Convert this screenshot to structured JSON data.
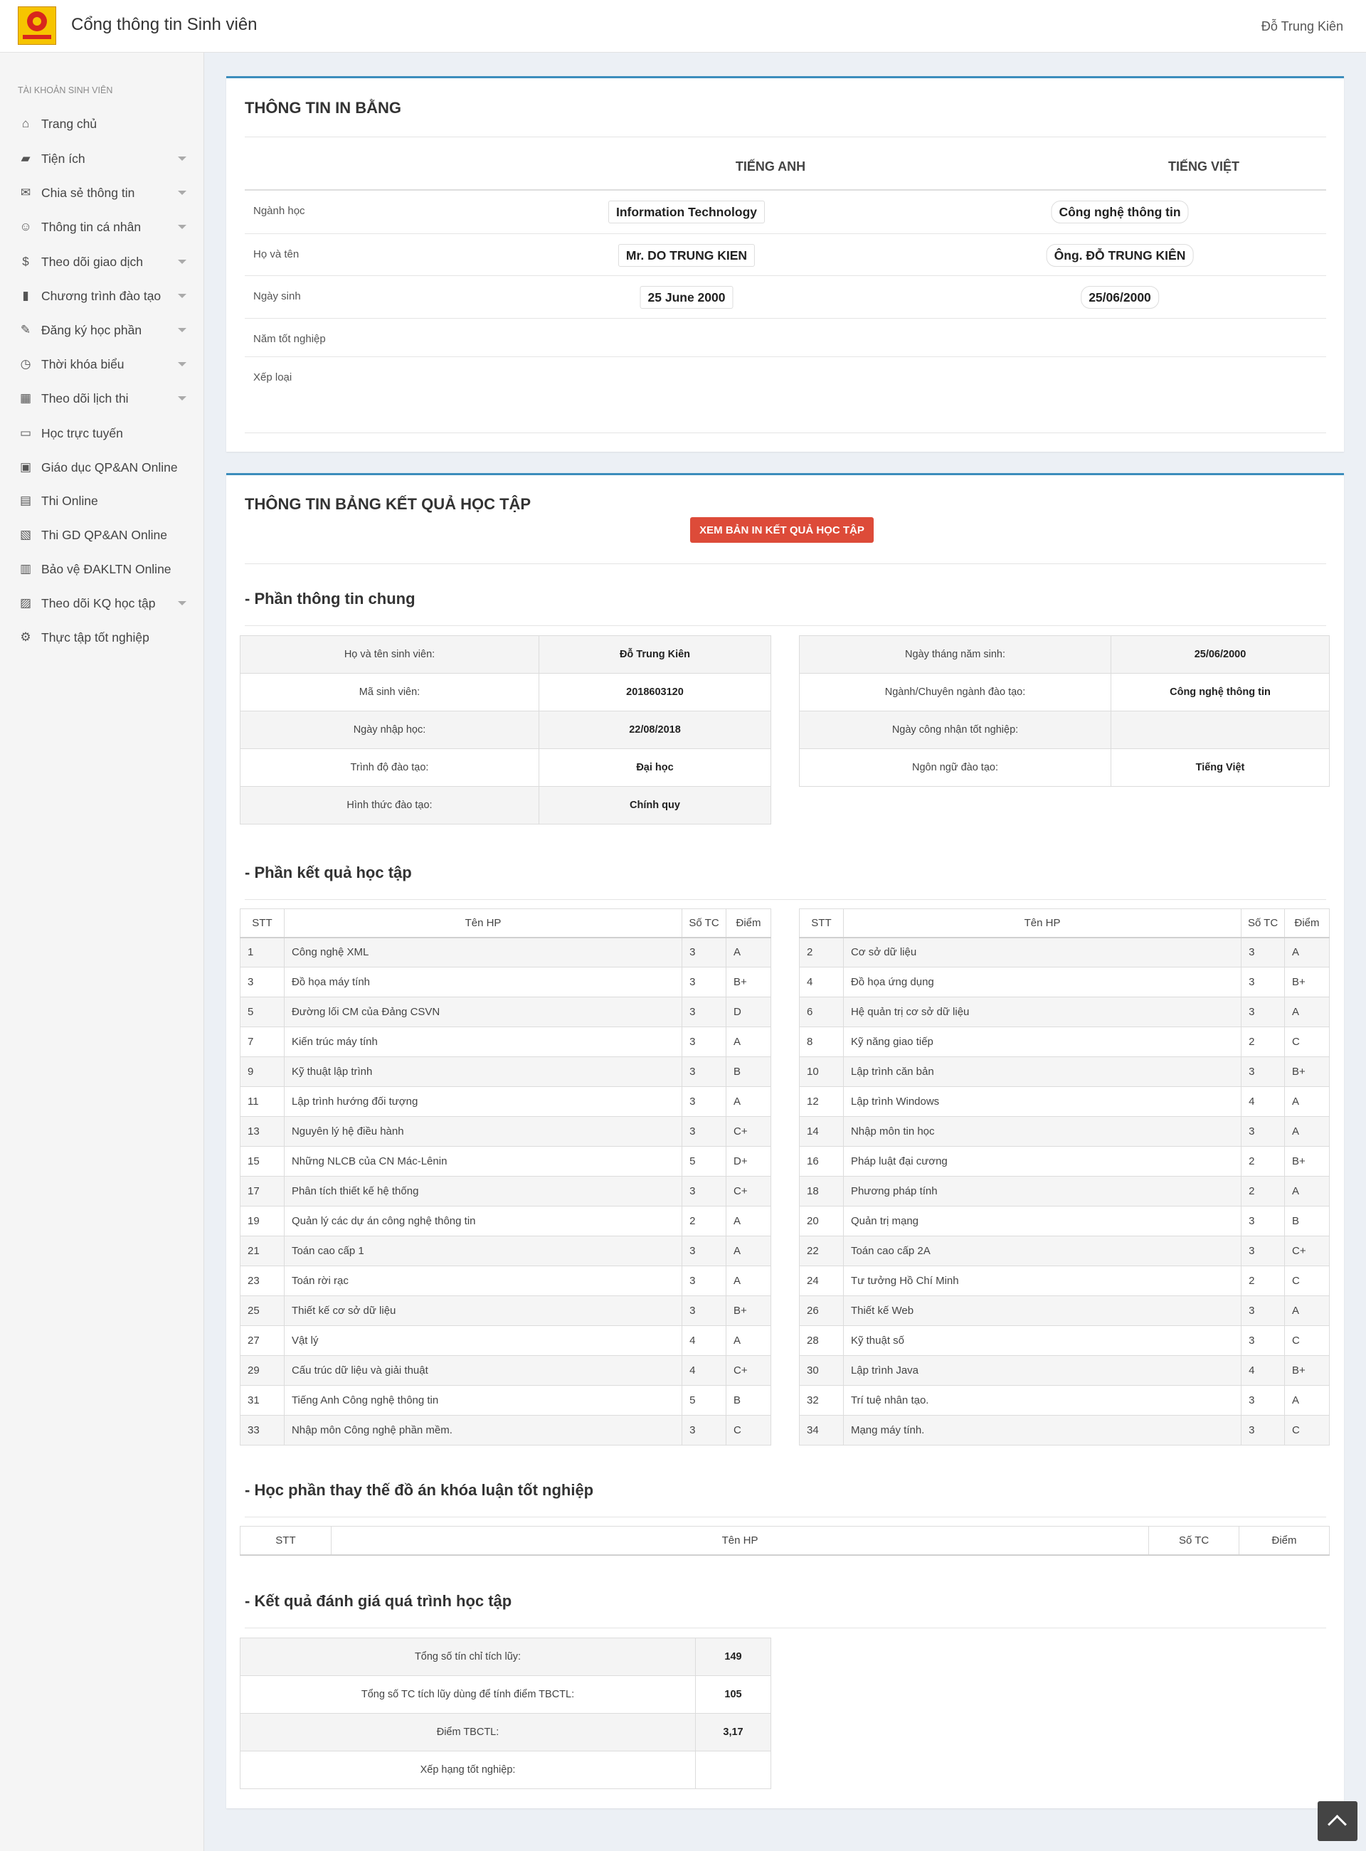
{
  "header": {
    "app_title": "Cổng thông tin Sinh viên",
    "user_name": "Đỗ Trung Kiên"
  },
  "sidebar": {
    "heading": "TÀI KHOẢN SINH VIÊN",
    "items": [
      {
        "label": "Trang chủ",
        "icon": "home-icon",
        "glyph": "⌂",
        "expandable": false
      },
      {
        "label": "Tiện ích",
        "icon": "book-icon",
        "glyph": "▰",
        "expandable": true
      },
      {
        "label": "Chia sẻ thông tin",
        "icon": "chat-icon",
        "glyph": "✉",
        "expandable": true
      },
      {
        "label": "Thông tin cá nhân",
        "icon": "face-icon",
        "glyph": "☺",
        "expandable": true
      },
      {
        "label": "Theo dõi giao dịch",
        "icon": "money-icon",
        "glyph": "$",
        "expandable": true
      },
      {
        "label": "Chương trình đào tạo",
        "icon": "notebook-icon",
        "glyph": "▮",
        "expandable": true
      },
      {
        "label": "Đăng ký học phần",
        "icon": "register-icon",
        "glyph": "✎",
        "expandable": true
      },
      {
        "label": "Thời khóa biểu",
        "icon": "alarm-clock-icon",
        "glyph": "◷",
        "expandable": true
      },
      {
        "label": "Theo dõi lịch thi",
        "icon": "calendar-icon",
        "glyph": "▦",
        "expandable": true
      },
      {
        "label": "Học trực tuyến",
        "icon": "laptop-icon",
        "glyph": "▭",
        "expandable": false
      },
      {
        "label": "Giáo dục QP&AN Online",
        "icon": "bus-icon",
        "glyph": "▣",
        "expandable": false
      },
      {
        "label": "Thi Online",
        "icon": "document-icon",
        "glyph": "▤",
        "expandable": false
      },
      {
        "label": "Thi GD QP&AN Online",
        "icon": "wallet-icon",
        "glyph": "▧",
        "expandable": false
      },
      {
        "label": "Bảo vệ ĐAKLTN Online",
        "icon": "report-icon",
        "glyph": "▥",
        "expandable": false
      },
      {
        "label": "Theo dõi KQ học tập",
        "icon": "transcript-icon",
        "glyph": "▨",
        "expandable": true
      },
      {
        "label": "Thực tập tốt nghiệp",
        "icon": "hierarchy-icon",
        "glyph": "⚙",
        "expandable": false
      }
    ]
  },
  "print_info": {
    "title": "THÔNG TIN IN BẰNG",
    "col_en": "TIẾNG ANH",
    "col_vi": "TIẾNG VIỆT",
    "rows": [
      {
        "label": "Ngành học",
        "en": "Information Technology",
        "vi": "Công nghệ thông tin"
      },
      {
        "label": "Họ và tên",
        "en": "Mr. DO TRUNG KIEN",
        "vi": "Ông. ĐỖ TRUNG KIÊN"
      },
      {
        "label": "Ngày sinh",
        "en": "25 June 2000",
        "vi": "25/06/2000"
      },
      {
        "label": "Năm tốt nghiệp",
        "en": "",
        "vi": ""
      },
      {
        "label": "Xếp loại",
        "en": "",
        "vi": ""
      }
    ]
  },
  "results": {
    "title": "THÔNG TIN BẢNG KẾT QUẢ HỌC TẬP",
    "print_button": "XEM BẢN IN KẾT QUẢ HỌC TẬP",
    "general_title": "- Phần thông tin chung",
    "general_left": [
      {
        "label": "Họ và tên sinh viên:",
        "value": "Đỗ Trung Kiên"
      },
      {
        "label": "Mã sinh viên:",
        "value": "2018603120"
      },
      {
        "label": "Ngày nhập học:",
        "value": "22/08/2018"
      },
      {
        "label": "Trình độ đào tạo:",
        "value": "Đại học"
      },
      {
        "label": "Hình thức đào tạo:",
        "value": "Chính quy"
      }
    ],
    "general_right": [
      {
        "label": "Ngày tháng năm sinh:",
        "value": "25/06/2000"
      },
      {
        "label": "Ngành/Chuyên ngành đào tạo:",
        "value": "Công nghệ thông tin"
      },
      {
        "label": "Ngày công nhận tốt nghiệp:",
        "value": ""
      },
      {
        "label": "Ngôn ngữ đào tạo:",
        "value": "Tiếng Việt"
      }
    ],
    "grades_title": "- Phần kết quả học tập",
    "grade_headers": [
      "STT",
      "Tên HP",
      "Số TC",
      "Điểm"
    ],
    "grades_left": [
      [
        "1",
        "Công nghệ XML",
        "3",
        "A"
      ],
      [
        "3",
        "Đồ họa máy tính",
        "3",
        "B+"
      ],
      [
        "5",
        "Đường lối CM của Đảng CSVN",
        "3",
        "D"
      ],
      [
        "7",
        "Kiến trúc máy tính",
        "3",
        "A"
      ],
      [
        "9",
        "Kỹ thuật lập trình",
        "3",
        "B"
      ],
      [
        "11",
        "Lập trình hướng đối tượng",
        "3",
        "A"
      ],
      [
        "13",
        "Nguyên lý hệ điều hành",
        "3",
        "C+"
      ],
      [
        "15",
        "Những NLCB của CN Mác-Lênin",
        "5",
        "D+"
      ],
      [
        "17",
        "Phân tích thiết kế hệ thống",
        "3",
        "C+"
      ],
      [
        "19",
        "Quản lý các dự án công nghệ thông tin",
        "2",
        "A"
      ],
      [
        "21",
        "Toán cao cấp 1",
        "3",
        "A"
      ],
      [
        "23",
        "Toán rời rạc",
        "3",
        "A"
      ],
      [
        "25",
        "Thiết kế cơ sở dữ liệu",
        "3",
        "B+"
      ],
      [
        "27",
        "Vật lý",
        "4",
        "A"
      ],
      [
        "29",
        "Cấu trúc dữ liệu và giải thuật",
        "4",
        "C+"
      ],
      [
        "31",
        "Tiếng Anh Công nghệ thông tin",
        "5",
        "B"
      ],
      [
        "33",
        "Nhập môn Công nghệ phần mềm.",
        "3",
        "C"
      ]
    ],
    "grades_right": [
      [
        "2",
        "Cơ sở dữ liệu",
        "3",
        "A"
      ],
      [
        "4",
        "Đồ họa ứng dụng",
        "3",
        "B+"
      ],
      [
        "6",
        "Hệ quản trị cơ sở dữ liệu",
        "3",
        "A"
      ],
      [
        "8",
        "Kỹ năng giao tiếp",
        "2",
        "C"
      ],
      [
        "10",
        "Lập trình căn bản",
        "3",
        "B+"
      ],
      [
        "12",
        "Lập trình Windows",
        "4",
        "A"
      ],
      [
        "14",
        "Nhập môn tin học",
        "3",
        "A"
      ],
      [
        "16",
        "Pháp luật đại cương",
        "2",
        "B+"
      ],
      [
        "18",
        "Phương pháp tính",
        "2",
        "A"
      ],
      [
        "20",
        "Quản trị mạng",
        "3",
        "B"
      ],
      [
        "22",
        "Toán cao cấp 2A",
        "3",
        "C+"
      ],
      [
        "24",
        "Tư tưởng Hồ Chí Minh",
        "2",
        "C"
      ],
      [
        "26",
        "Thiết kế Web",
        "3",
        "A"
      ],
      [
        "28",
        "Kỹ thuật số",
        "3",
        "C"
      ],
      [
        "30",
        "Lập trình Java",
        "4",
        "B+"
      ],
      [
        "32",
        "Trí tuệ nhân tạo.",
        "3",
        "A"
      ],
      [
        "34",
        "Mạng máy tính.",
        "3",
        "C"
      ]
    ],
    "replacement_title": "- Học phần thay thế đồ án khóa luận tốt nghiệp",
    "evaluation_title": "- Kết quả đánh giá quá trình học tập",
    "evaluation": [
      {
        "label": "Tổng số tín chỉ tích lũy:",
        "value": "149"
      },
      {
        "label": "Tổng số TC tích lũy dùng để tính điểm TBCTL:",
        "value": "105"
      },
      {
        "label": "Điểm TBCTL:",
        "value": "3,17"
      },
      {
        "label": "Xếp hạng tốt nghiệp:",
        "value": ""
      }
    ]
  }
}
